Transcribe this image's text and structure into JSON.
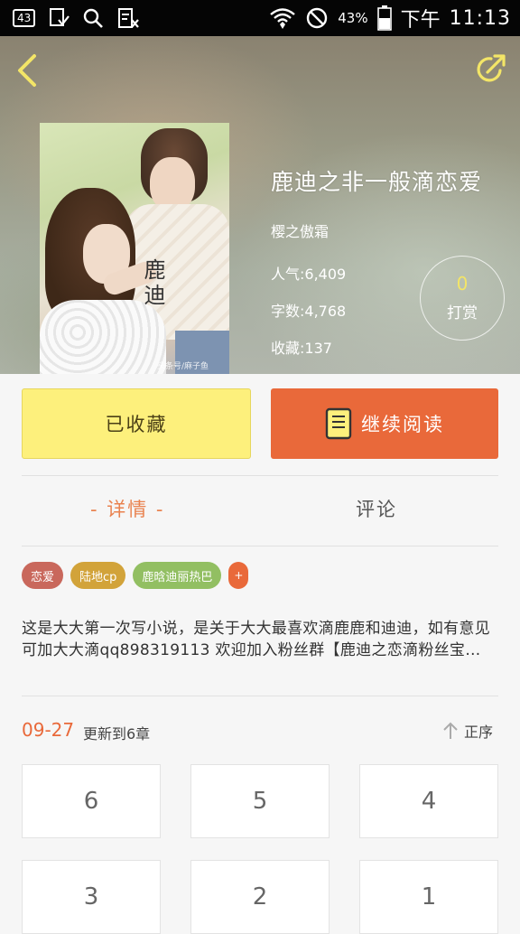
{
  "status_bar": {
    "notification_count": "43",
    "battery_percent": "43%",
    "ampm": "下午",
    "time": "11:13"
  },
  "book": {
    "cover_title": "鹿迪",
    "cover_watermark": "头条号/麻子鱼",
    "title": "鹿迪之非一般滴恋爱",
    "author": "樱之傲霜",
    "popularity": "人气:6,409",
    "word_count": "字数:4,768",
    "favorites": "收藏:137",
    "tip_count": "0",
    "tip_label": "打赏"
  },
  "actions": {
    "favorite_label": "已收藏",
    "continue_label": "继续阅读"
  },
  "tabs": {
    "detail": "- 详情 -",
    "comment": "评论"
  },
  "tags": [
    {
      "label": "恋爱",
      "color": "#c9685c"
    },
    {
      "label": "陆地cp",
      "color": "#d2a33a"
    },
    {
      "label": "鹿晗迪丽热巴",
      "color": "#92bf62"
    },
    {
      "label": "+",
      "color": "#e9693a"
    }
  ],
  "description": "这是大大第一次写小说，是关于大大最喜欢滴鹿鹿和迪迪，如有意见可加大大滴qq898319113 欢迎加入粉丝群【鹿迪之恋滴粉丝宝…",
  "chapters": {
    "update_date": "09-27",
    "update_text": "更新到6章",
    "sort_label": "正序",
    "items": [
      "6",
      "5",
      "4",
      "3",
      "2",
      "1"
    ]
  },
  "colors": {
    "accent_orange": "#e9693a",
    "favorite_yellow": "#fdf07c",
    "tip_yellow": "#f3e567"
  }
}
